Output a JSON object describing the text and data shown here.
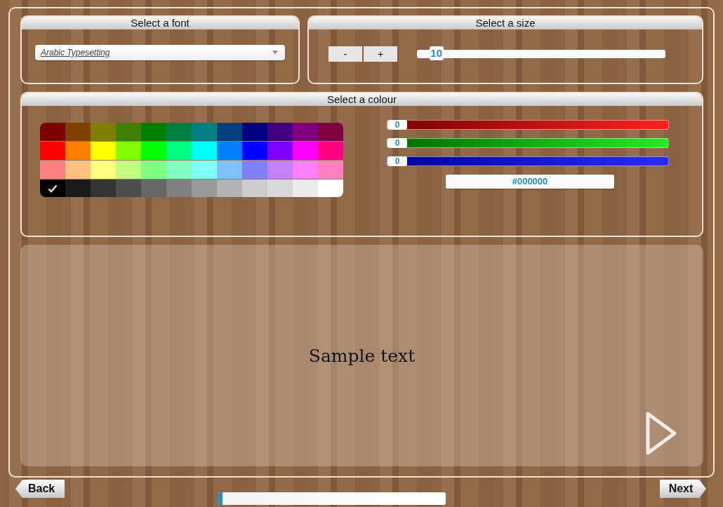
{
  "font_panel": {
    "title": "Select a font",
    "font_dropdown": {
      "value": "Arabic Typesetting"
    }
  },
  "size_panel": {
    "title": "Select a size",
    "buttons": [
      "-",
      "+"
    ],
    "size_slider": {
      "reading": "10",
      "level": 0.05
    }
  },
  "colour_panel": {
    "title": "Select a colour",
    "swatches": [
      {
        "color": "#800000",
        "selected": false
      },
      {
        "color": "#804000",
        "selected": false
      },
      {
        "color": "#808000",
        "selected": false
      },
      {
        "color": "#408000",
        "selected": false
      },
      {
        "color": "#008000",
        "selected": false
      },
      {
        "color": "#008040",
        "selected": false
      },
      {
        "color": "#008080",
        "selected": false
      },
      {
        "color": "#004080",
        "selected": false
      },
      {
        "color": "#000080",
        "selected": false
      },
      {
        "color": "#400080",
        "selected": false
      },
      {
        "color": "#800080",
        "selected": false
      },
      {
        "color": "#800040",
        "selected": false
      },
      {
        "color": "#ff0000",
        "selected": false
      },
      {
        "color": "#ff8000",
        "selected": false
      },
      {
        "color": "#ffff00",
        "selected": false
      },
      {
        "color": "#80ff00",
        "selected": false
      },
      {
        "color": "#00ff00",
        "selected": false
      },
      {
        "color": "#00ff80",
        "selected": false
      },
      {
        "color": "#00ffff",
        "selected": false
      },
      {
        "color": "#0080ff",
        "selected": false
      },
      {
        "color": "#0000ff",
        "selected": false
      },
      {
        "color": "#8000ff",
        "selected": false
      },
      {
        "color": "#ff00ff",
        "selected": false
      },
      {
        "color": "#ff0080",
        "selected": false
      },
      {
        "color": "#ff8080",
        "selected": false
      },
      {
        "color": "#ffc080",
        "selected": false
      },
      {
        "color": "#ffff80",
        "selected": false
      },
      {
        "color": "#c0ff80",
        "selected": false
      },
      {
        "color": "#80ff80",
        "selected": false
      },
      {
        "color": "#80ffc0",
        "selected": false
      },
      {
        "color": "#80ffff",
        "selected": false
      },
      {
        "color": "#80c0ff",
        "selected": false
      },
      {
        "color": "#8080ff",
        "selected": false
      },
      {
        "color": "#c080ff",
        "selected": false
      },
      {
        "color": "#ff80ff",
        "selected": false
      },
      {
        "color": "#ff80c0",
        "selected": false
      },
      {
        "color": "#000000",
        "selected": true
      },
      {
        "color": "#1a1a1a",
        "selected": false
      },
      {
        "color": "#333333",
        "selected": false
      },
      {
        "color": "#4d4d4d",
        "selected": false
      },
      {
        "color": "#666666",
        "selected": false
      },
      {
        "color": "#808080",
        "selected": false
      },
      {
        "color": "#999999",
        "selected": false
      },
      {
        "color": "#b3b3b3",
        "selected": false
      },
      {
        "color": "#cccccc",
        "selected": false
      },
      {
        "color": "#d9d9d9",
        "selected": false
      },
      {
        "color": "#ebebeb",
        "selected": false
      },
      {
        "color": "#ffffff",
        "selected": false
      }
    ],
    "channels": [
      {
        "kind": "red",
        "reading": "0",
        "level": 0
      },
      {
        "kind": "green",
        "reading": "0",
        "level": 0
      },
      {
        "kind": "blue",
        "reading": "0",
        "level": 0
      }
    ],
    "hex_field": {
      "value": "#000000"
    }
  },
  "preview": {
    "sample_text": "Sample text"
  },
  "navigation": {
    "back": "Back",
    "next": "Next",
    "progress": {
      "level": 0.02
    }
  }
}
